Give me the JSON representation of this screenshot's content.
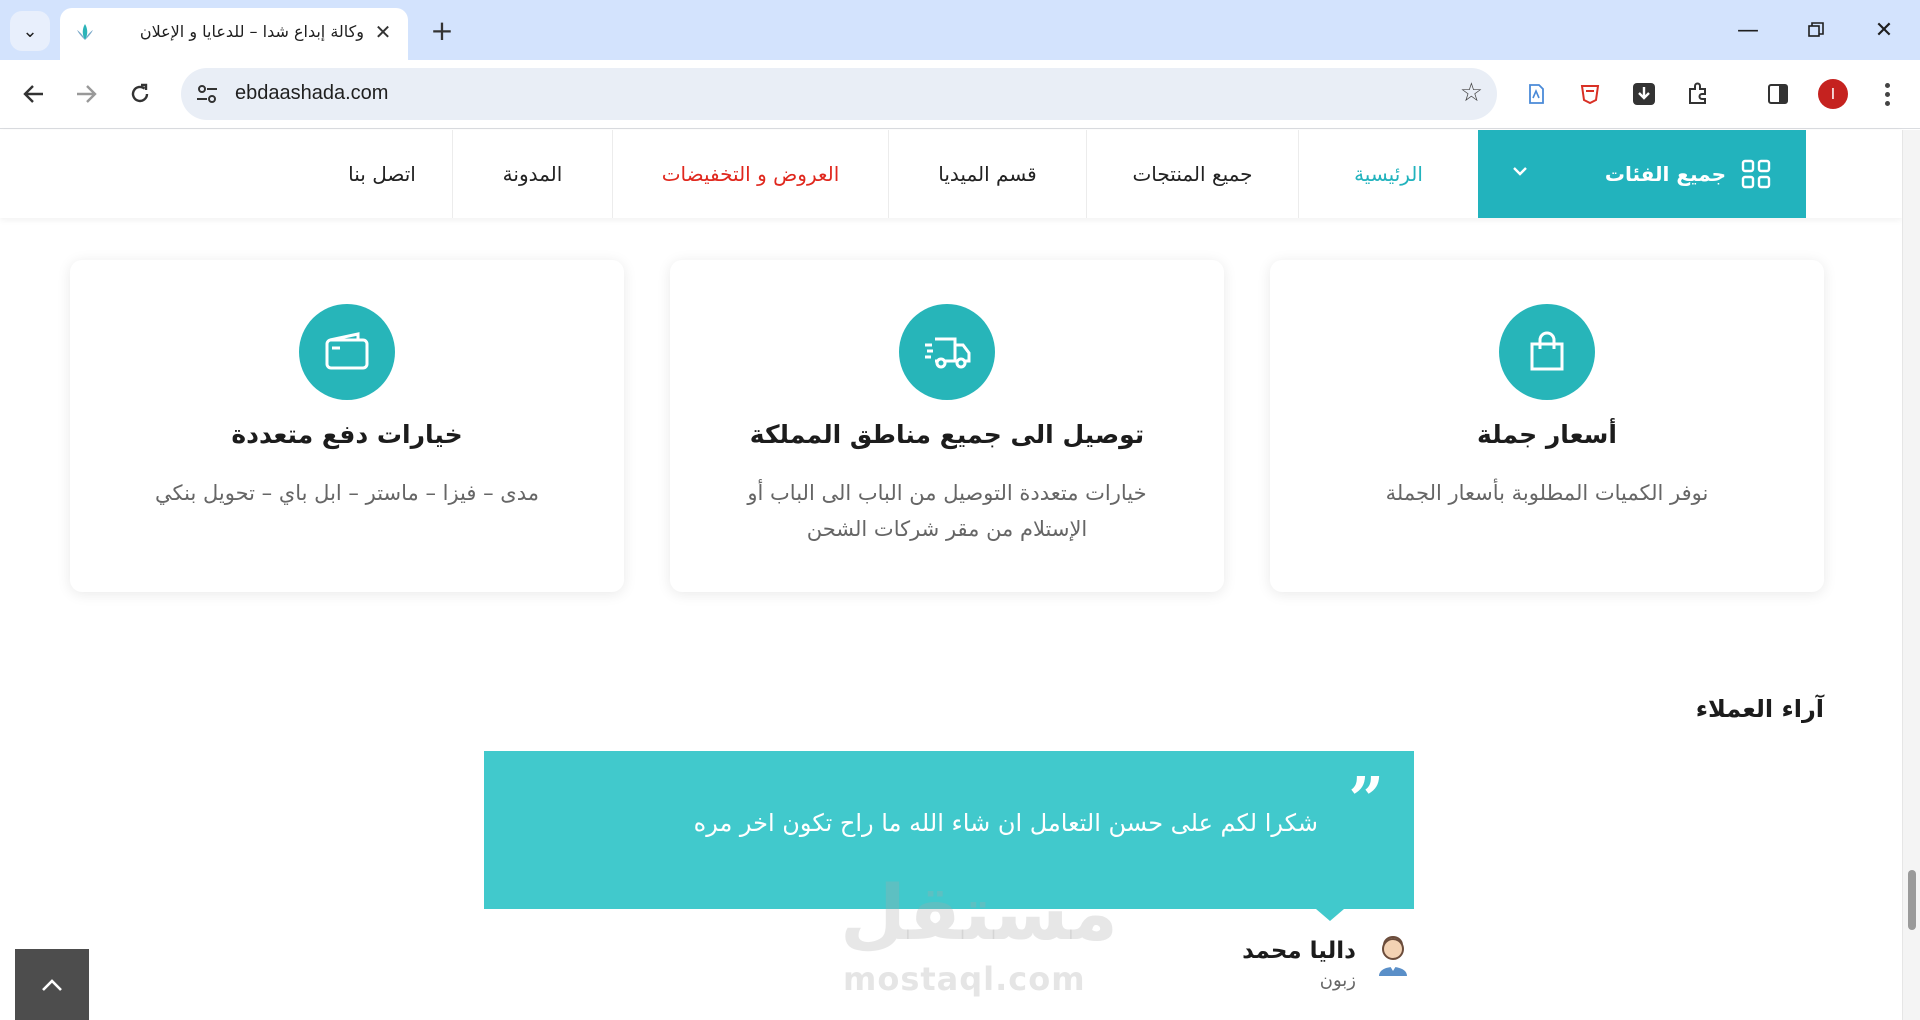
{
  "browser": {
    "tab_title": "وكالة إبداع شدا – للدعايا و الإعلان",
    "url": "ebdaashada.com",
    "profile_initial": "I"
  },
  "nav": {
    "all_categories": "جميع الفئات",
    "items": [
      {
        "label": "الرئيسية"
      },
      {
        "label": "جميع المنتجات"
      },
      {
        "label": "قسم الميديا"
      },
      {
        "label": "العروض و التخفيضات"
      },
      {
        "label": "المدونة"
      },
      {
        "label": "اتصل بنا"
      }
    ]
  },
  "features": [
    {
      "icon": "shopping-bag-icon",
      "title": "أسعار جملة",
      "desc": "نوفر الكميات المطلوبة بأسعار الجملة"
    },
    {
      "icon": "delivery-truck-icon",
      "title": "توصيل الى جميع مناطق المملكة",
      "desc": "خيارات متعددة التوصيل من الباب الى الباب أو الإستلام من مقر شركات الشحن"
    },
    {
      "icon": "wallet-icon",
      "title": "خيارات دفع متعددة",
      "desc": "مدى – فيزا – ماستر – ابل باي – تحويل بنكي"
    }
  ],
  "reviews": {
    "title": "آراء العملاء",
    "text": "شكرا لكم على حسن التعامل ان شاء الله ما راح تكون اخر مره",
    "name": "داليا محمد",
    "role": "زبون"
  },
  "watermark": {
    "arabic": "مستقل",
    "latin": "mostaql.com"
  },
  "colors": {
    "accent": "#22b3bd",
    "review_bg": "#41c9cc",
    "sale": "#e0281e",
    "chrome_tabbar": "#d3e3fd"
  }
}
